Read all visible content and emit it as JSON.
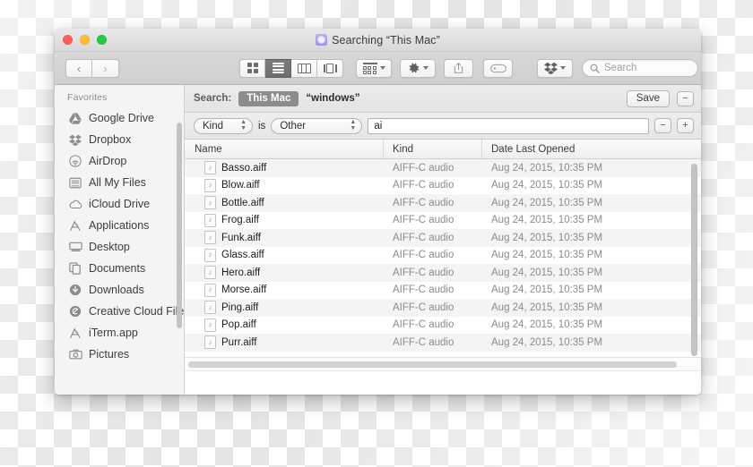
{
  "window": {
    "title": "Searching “This Mac”",
    "title_icon": "search-folder-icon",
    "traffic_lights": {
      "close": "close-button",
      "minimize": "minimize-button",
      "maximize": "maximize-button"
    }
  },
  "toolbar": {
    "back_glyph": "‹",
    "forward_glyph": "›",
    "views": [
      {
        "name": "icon-view",
        "active": false
      },
      {
        "name": "list-view",
        "active": true
      },
      {
        "name": "column-view",
        "active": false
      },
      {
        "name": "coverflow-view",
        "active": false
      }
    ],
    "arrange_icon": "arrange-icon",
    "action_icon": "gear-icon",
    "share_icon": "share-icon",
    "tag_icon": "tag-icon",
    "dropbox_icon": "dropbox-icon",
    "chevron": "chevron-down-icon"
  },
  "search": {
    "placeholder": "Search",
    "icon": "search-icon"
  },
  "scope_bar": {
    "label": "Search:",
    "scopes": [
      {
        "label": "This Mac",
        "selected": true
      },
      {
        "label": "“windows”",
        "selected": false
      }
    ],
    "save_label": "Save",
    "remove_label": "−"
  },
  "filter_bar": {
    "attribute": "Kind",
    "operator": "is",
    "value_popup": "Other",
    "text_value": "ai",
    "remove_label": "−",
    "add_label": "+"
  },
  "columns": [
    {
      "key": "name",
      "label": "Name"
    },
    {
      "key": "kind",
      "label": "Kind"
    },
    {
      "key": "date",
      "label": "Date Last Opened"
    }
  ],
  "files": [
    {
      "name": "Basso.aiff",
      "kind": "AIFF-C audio",
      "date": "Aug 24, 2015, 10:35 PM",
      "icon": "audio-file-icon"
    },
    {
      "name": "Blow.aiff",
      "kind": "AIFF-C audio",
      "date": "Aug 24, 2015, 10:35 PM",
      "icon": "audio-file-icon"
    },
    {
      "name": "Bottle.aiff",
      "kind": "AIFF-C audio",
      "date": "Aug 24, 2015, 10:35 PM",
      "icon": "audio-file-icon"
    },
    {
      "name": "Frog.aiff",
      "kind": "AIFF-C audio",
      "date": "Aug 24, 2015, 10:35 PM",
      "icon": "audio-file-icon"
    },
    {
      "name": "Funk.aiff",
      "kind": "AIFF-C audio",
      "date": "Aug 24, 2015, 10:35 PM",
      "icon": "audio-file-icon"
    },
    {
      "name": "Glass.aiff",
      "kind": "AIFF-C audio",
      "date": "Aug 24, 2015, 10:35 PM",
      "icon": "audio-file-icon"
    },
    {
      "name": "Hero.aiff",
      "kind": "AIFF-C audio",
      "date": "Aug 24, 2015, 10:35 PM",
      "icon": "audio-file-icon"
    },
    {
      "name": "Morse.aiff",
      "kind": "AIFF-C audio",
      "date": "Aug 24, 2015, 10:35 PM",
      "icon": "audio-file-icon"
    },
    {
      "name": "Ping.aiff",
      "kind": "AIFF-C audio",
      "date": "Aug 24, 2015, 10:35 PM",
      "icon": "audio-file-icon"
    },
    {
      "name": "Pop.aiff",
      "kind": "AIFF-C audio",
      "date": "Aug 24, 2015, 10:35 PM",
      "icon": "audio-file-icon"
    },
    {
      "name": "Purr.aiff",
      "kind": "AIFF-C audio",
      "date": "Aug 24, 2015, 10:35 PM",
      "icon": "audio-file-icon"
    }
  ],
  "sidebar": {
    "section_label": "Favorites",
    "items": [
      {
        "label": "Google Drive",
        "icon": "google-drive-icon"
      },
      {
        "label": "Dropbox",
        "icon": "dropbox-icon"
      },
      {
        "label": "AirDrop",
        "icon": "airdrop-icon"
      },
      {
        "label": "All My Files",
        "icon": "all-my-files-icon"
      },
      {
        "label": "iCloud Drive",
        "icon": "icloud-icon"
      },
      {
        "label": "Applications",
        "icon": "applications-icon"
      },
      {
        "label": "Desktop",
        "icon": "desktop-icon"
      },
      {
        "label": "Documents",
        "icon": "documents-icon"
      },
      {
        "label": "Downloads",
        "icon": "downloads-icon"
      },
      {
        "label": "Creative Cloud Files",
        "icon": "creative-cloud-icon"
      },
      {
        "label": "iTerm.app",
        "icon": "app-icon"
      },
      {
        "label": "Pictures",
        "icon": "pictures-icon"
      }
    ]
  },
  "colors": {
    "close": "#ff5f57",
    "minimize": "#ffbd2e",
    "maximize": "#28c940",
    "scope_pill": "#8c8c8c",
    "title_icon": "#9b93de"
  }
}
